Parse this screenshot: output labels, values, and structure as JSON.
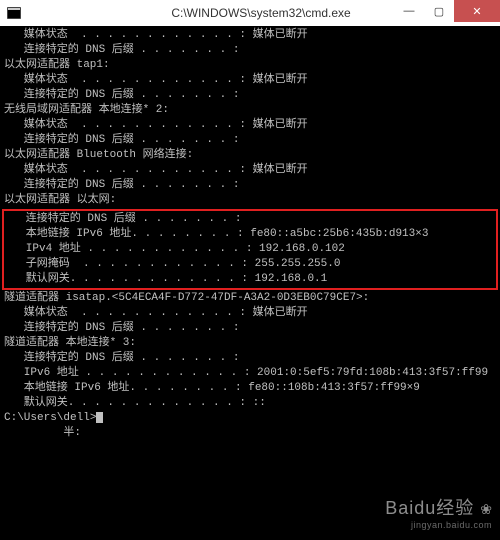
{
  "title": "C:\\WINDOWS\\system32\\cmd.exe",
  "winbtns": {
    "min": "—",
    "max": "▢",
    "close": "✕"
  },
  "scroll_up": "▲",
  "sections": [
    {
      "lines": [
        "   媒体状态  . . . . . . . . . . . . : 媒体已断开",
        "   连接特定的 DNS 后缀 . . . . . . . :"
      ]
    },
    {
      "header": "以太网适配器 tap1:",
      "lines": [
        "   媒体状态  . . . . . . . . . . . . : 媒体已断开",
        "   连接特定的 DNS 后缀 . . . . . . . :"
      ]
    },
    {
      "header": "无线局域网适配器 本地连接* 2:",
      "lines": [
        "   媒体状态  . . . . . . . . . . . . : 媒体已断开",
        "   连接特定的 DNS 后缀 . . . . . . . :"
      ]
    },
    {
      "header": "以太网适配器 Bluetooth 网络连接:",
      "lines": [
        "   媒体状态  . . . . . . . . . . . . : 媒体已断开",
        "   连接特定的 DNS 后缀 . . . . . . . :"
      ]
    },
    {
      "header": "以太网适配器 以太网:",
      "boxed": true,
      "lines": [
        "   连接特定的 DNS 后缀 . . . . . . . :",
        "   本地链接 IPv6 地址. . . . . . . . : fe80::a5bc:25b6:435b:d913×3",
        "   IPv4 地址 . . . . . . . . . . . . : 192.168.0.102",
        "   子网掩码  . . . . . . . . . . . . : 255.255.255.0",
        "   默认网关. . . . . . . . . . . . . : 192.168.0.1"
      ]
    },
    {
      "header": "隧道适配器 isatap.<5C4ECA4F-D772-47DF-A3A2-0D3EB0C79CE7>:",
      "lines": [
        "   媒体状态  . . . . . . . . . . . . : 媒体已断开",
        "   连接特定的 DNS 后缀 . . . . . . . :"
      ]
    },
    {
      "header": "隧道适配器 本地连接* 3:",
      "lines": [
        "   连接特定的 DNS 后缀 . . . . . . . :",
        "   IPv6 地址 . . . . . . . . . . . . : 2001:0:5ef5:79fd:108b:413:3f57:ff99",
        "   本地链接 IPv6 地址. . . . . . . . : fe80::108b:413:3f57:ff99×9",
        "   默认网关. . . . . . . . . . . . . : ::"
      ]
    }
  ],
  "prompt": "C:\\Users\\dell>",
  "tail": "         半:",
  "watermark": {
    "brand": "Baidu",
    "sub": "经验",
    "url": "jingyan.baidu.com",
    "paw": "❀"
  }
}
